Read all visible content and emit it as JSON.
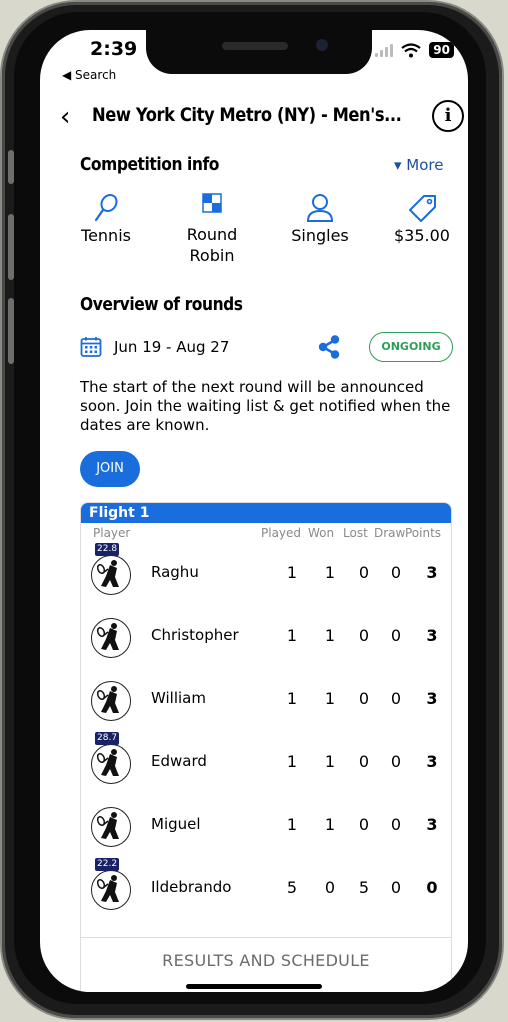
{
  "status_bar": {
    "time": "2:39",
    "back_label": "◀ Search",
    "battery": "90"
  },
  "nav": {
    "title": "New York City Metro (NY) - Men's...",
    "back_icon": "chevron-left-icon",
    "info_icon": "info-icon"
  },
  "competition_info": {
    "title": "Competition info",
    "more_label": "▾ More",
    "items": [
      {
        "icon": "racket-icon",
        "label": "Tennis"
      },
      {
        "icon": "round-robin-icon",
        "label": "Round\nRobin"
      },
      {
        "icon": "user-icon",
        "label": "Singles"
      },
      {
        "icon": "price-tag-icon",
        "label": "$35.00"
      }
    ]
  },
  "rounds": {
    "title": "Overview of rounds",
    "date_range": "Jun 19 - Aug 27",
    "status": "ONGOING",
    "announcement": "The start of the next round will be announced soon. Join the waiting list & get notified when the dates are known.",
    "join_label": "JOIN"
  },
  "flight": {
    "name": "Flight 1",
    "columns": {
      "player": "Player",
      "played": "Played",
      "won": "Won",
      "lost": "Lost",
      "draw": "Draw",
      "points": "Points"
    },
    "rows": [
      {
        "name": "Raghu",
        "rating": "22.8",
        "played": "1",
        "won": "1",
        "lost": "0",
        "draw": "0",
        "points": "3"
      },
      {
        "name": "Christopher",
        "rating": "",
        "played": "1",
        "won": "1",
        "lost": "0",
        "draw": "0",
        "points": "3"
      },
      {
        "name": "William",
        "rating": "",
        "played": "1",
        "won": "1",
        "lost": "0",
        "draw": "0",
        "points": "3"
      },
      {
        "name": "Edward",
        "rating": "28.7",
        "played": "1",
        "won": "1",
        "lost": "0",
        "draw": "0",
        "points": "3"
      },
      {
        "name": "Miguel",
        "rating": "",
        "played": "1",
        "won": "1",
        "lost": "0",
        "draw": "0",
        "points": "3"
      },
      {
        "name": "Ildebrando",
        "rating": "22.2",
        "played": "5",
        "won": "0",
        "lost": "5",
        "draw": "0",
        "points": "0"
      }
    ],
    "results_label": "RESULTS AND SCHEDULE"
  },
  "colors": {
    "accent": "#1a6ddd",
    "status_green": "#2e9e57",
    "link_blue": "#1e4f9b",
    "badge_navy": "#1a2266"
  }
}
